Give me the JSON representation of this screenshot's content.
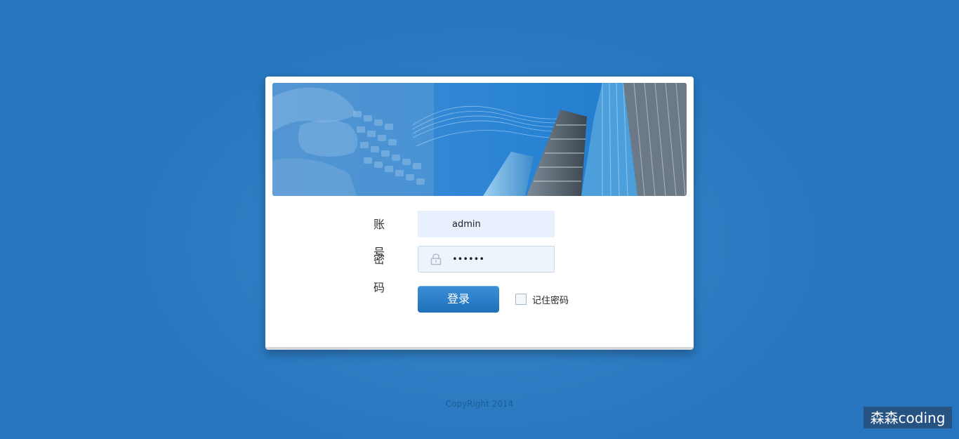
{
  "form": {
    "account_label": "账号",
    "account_value": "admin",
    "password_label": "密码",
    "password_value": "••••••",
    "password_icon": "lock-icon",
    "login_button": "登录",
    "remember_label": "记住密码",
    "remember_checked": false
  },
  "footer": {
    "copyright": "CopyRight 2014"
  },
  "watermark": "森森coding",
  "colors": {
    "background": "#2e7dc3",
    "button": "#2a7fc9"
  }
}
